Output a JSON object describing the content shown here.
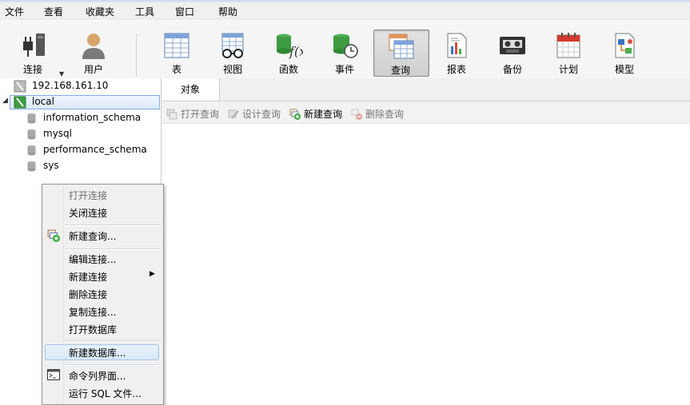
{
  "menu": [
    "文件",
    "查看",
    "收藏夹",
    "工具",
    "窗口",
    "帮助"
  ],
  "toolbar": {
    "connect": "连接",
    "user": "用户",
    "table": "表",
    "view": "视图",
    "function": "函数",
    "event": "事件",
    "query": "查询",
    "report": "报表",
    "backup": "备份",
    "schedule": "计划",
    "model": "模型"
  },
  "tree": {
    "conn1": "192.168.161.10",
    "conn2": "local",
    "dbs": [
      "information_schema",
      "mysql",
      "performance_schema",
      "sys"
    ]
  },
  "tabs": {
    "objects": "对象"
  },
  "subbar": {
    "open_query": "打开查询",
    "design_query": "设计查询",
    "new_query": "新建查询",
    "delete_query": "删除查询"
  },
  "context_menu": {
    "open_conn": "打开连接",
    "close_conn": "关闭连接",
    "new_query": "新建查询...",
    "edit_conn": "编辑连接...",
    "new_conn": "新建连接",
    "delete_conn": "删除连接",
    "copy_conn": "复制连接...",
    "open_db": "打开数据库",
    "new_db": "新建数据库...",
    "console": "命令列界面...",
    "run_sql": "运行 SQL 文件..."
  }
}
